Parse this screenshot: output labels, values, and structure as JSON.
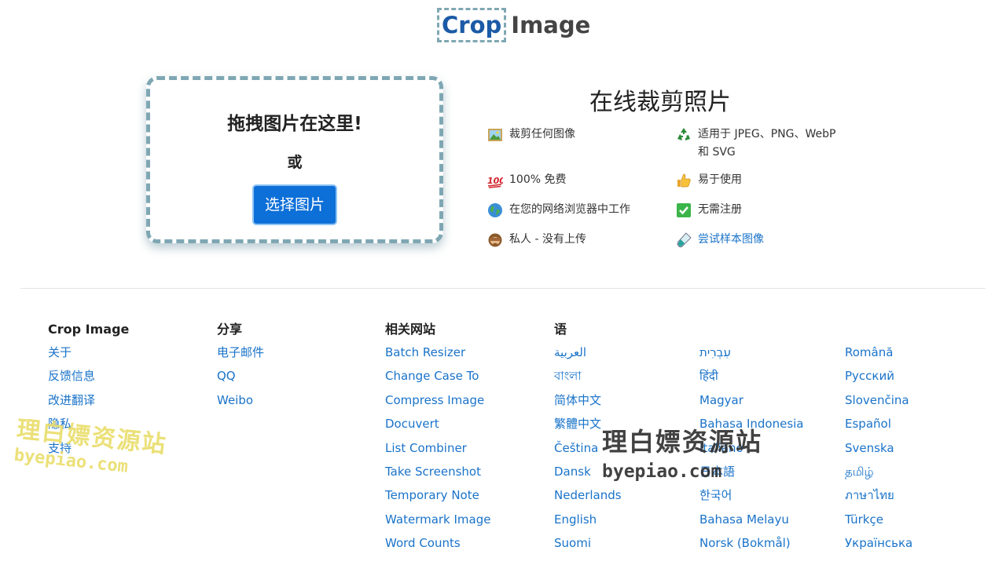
{
  "logo": {
    "part1": "Crop",
    "part2": "Image"
  },
  "dropzone": {
    "title": "拖拽图片在这里!",
    "or": "或",
    "button": "选择图片"
  },
  "features": {
    "title": "在线裁剪照片",
    "items": [
      {
        "icon": "picture-icon",
        "text": "裁剪任何图像"
      },
      {
        "icon": "recycle-icon",
        "text": "适用于 JPEG、PNG、WebP 和 SVG"
      },
      {
        "icon": "hundred-icon",
        "text": "100% 免费"
      },
      {
        "icon": "thumbs-up-icon",
        "text": "易于使用"
      },
      {
        "icon": "globe-icon",
        "text": "在您的网络浏览器中工作"
      },
      {
        "icon": "check-icon",
        "text": "无需注册"
      },
      {
        "icon": "monkey-icon",
        "text": "私人 - 没有上传"
      },
      {
        "icon": "test-tube-icon",
        "text": "尝试样本图像"
      }
    ]
  },
  "footer": {
    "col1": {
      "heading": "Crop Image",
      "links": [
        "关于",
        "反馈信息",
        "改进翻译",
        "隐私",
        "支持"
      ]
    },
    "col2": {
      "heading": "分享",
      "links": [
        "电子邮件",
        "QQ",
        "Weibo"
      ]
    },
    "col3": {
      "heading": "相关网站",
      "links": [
        "Batch Resizer",
        "Change Case To",
        "Compress Image",
        "Docuvert",
        "List Combiner",
        "Take Screenshot",
        "Temporary Note",
        "Watermark Image",
        "Word Counts"
      ]
    },
    "col4": {
      "heading": "语",
      "links": [
        "العربية",
        "বাংলা",
        "简体中文",
        "繁體中文",
        "Čeština",
        "Dansk",
        "Nederlands",
        "English",
        "Suomi"
      ]
    },
    "col5": {
      "links": [
        "עִבְרִית",
        "हिंदी",
        "Magyar",
        "Bahasa Indonesia",
        "Italiano",
        "日本語",
        "한국어",
        "Bahasa Melayu",
        "Norsk (Bokmål)"
      ]
    },
    "col6": {
      "links": [
        "Română",
        "Русский",
        "Slovenčina",
        "Español",
        "Svenska",
        "தமிழ்",
        "ภาษาไทย",
        "Türkçe",
        "Українська"
      ]
    }
  },
  "watermark": {
    "cn": "理白嫖资源站",
    "en": "byepiao.com"
  },
  "colors": {
    "accent": "#0d6fd8",
    "link": "#1a73c9",
    "dash": "#7fa7b3"
  }
}
